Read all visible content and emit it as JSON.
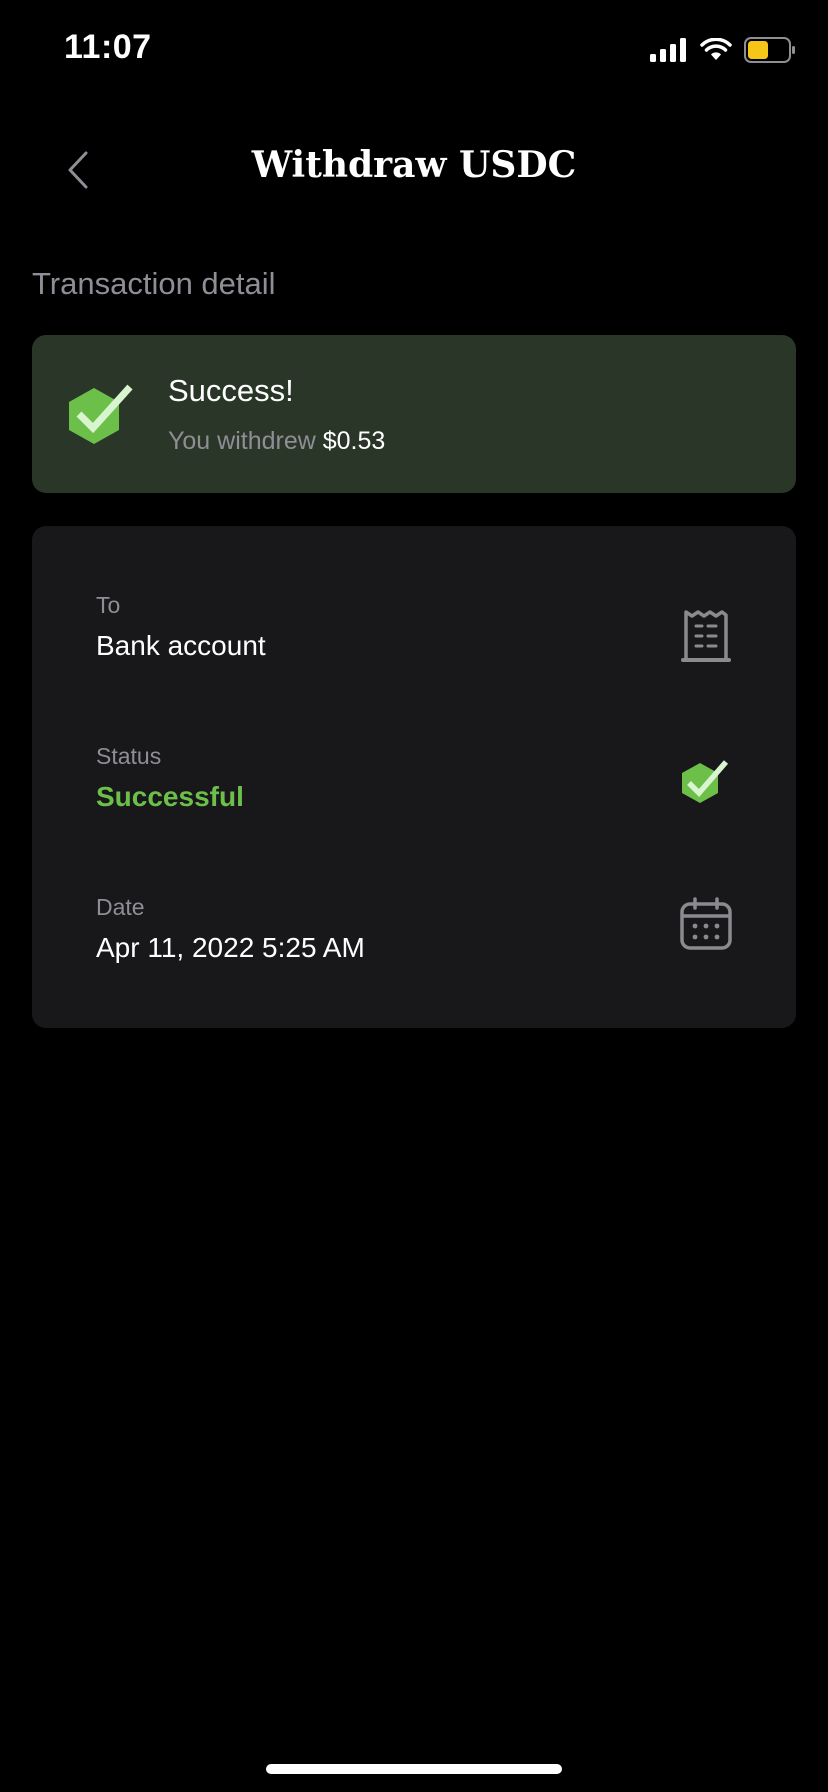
{
  "status_bar": {
    "time": "11:07",
    "battery_color": "#f5c518"
  },
  "nav": {
    "title": "Withdraw USDC",
    "back_icon": "chevron-left-icon"
  },
  "section": {
    "title": "Transaction detail"
  },
  "success_card": {
    "title": "Success!",
    "subtitle_prefix": "You withdrew",
    "amount": "$0.53",
    "background": "#2a3728",
    "accent": "#6cc04a"
  },
  "details": {
    "to": {
      "label": "To",
      "value": "Bank account",
      "icon": "receipt-icon"
    },
    "status": {
      "label": "Status",
      "value": "Successful",
      "icon": "check-hexagon-icon",
      "color": "#6cc04a"
    },
    "date": {
      "label": "Date",
      "value": "Apr 11, 2022 5:25 AM",
      "icon": "calendar-icon"
    }
  }
}
